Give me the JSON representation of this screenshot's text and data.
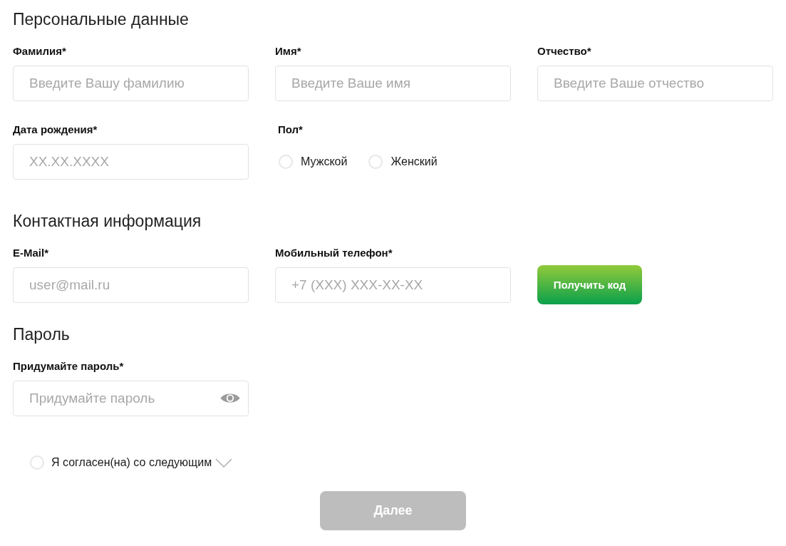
{
  "sections": [
    {
      "title": "Персональные данные",
      "rows": [
        [
          {
            "kind": "input",
            "label": "Фамилия*",
            "placeholder": "Введите Вашу фамилию"
          },
          {
            "kind": "input",
            "label": "Имя*",
            "placeholder": "Введите Ваше имя"
          },
          {
            "kind": "input",
            "label": "Отчество*",
            "placeholder": "Введите Ваше отчество"
          }
        ],
        [
          {
            "kind": "input",
            "label": "Дата рождения*",
            "placeholder": "XX.XX.XXXX"
          },
          {
            "kind": "radio_group",
            "label": "Пол*",
            "options": [
              {
                "label": "Мужской",
                "selected": false
              },
              {
                "label": "Женский",
                "selected": false
              }
            ]
          }
        ]
      ]
    },
    {
      "title": "Контактная информация",
      "rows": [
        [
          {
            "kind": "input",
            "label": "E-Mail*",
            "placeholder": "user@mail.ru"
          },
          {
            "kind": "input",
            "label": "Мобильный телефон*",
            "placeholder": "+7 (XXX) XXX-XX-XX"
          },
          {
            "kind": "button",
            "label": "Получить код"
          }
        ]
      ]
    },
    {
      "title": "Пароль",
      "rows": [
        [
          {
            "kind": "password",
            "label": "Придумайте пароль*",
            "placeholder": "Придумайте пароль"
          }
        ]
      ]
    }
  ],
  "agreement": {
    "label": "Я согласен(на) со следующим",
    "checked": false,
    "expanded": false
  },
  "submit": {
    "label": "Далее",
    "disabled": true
  }
}
